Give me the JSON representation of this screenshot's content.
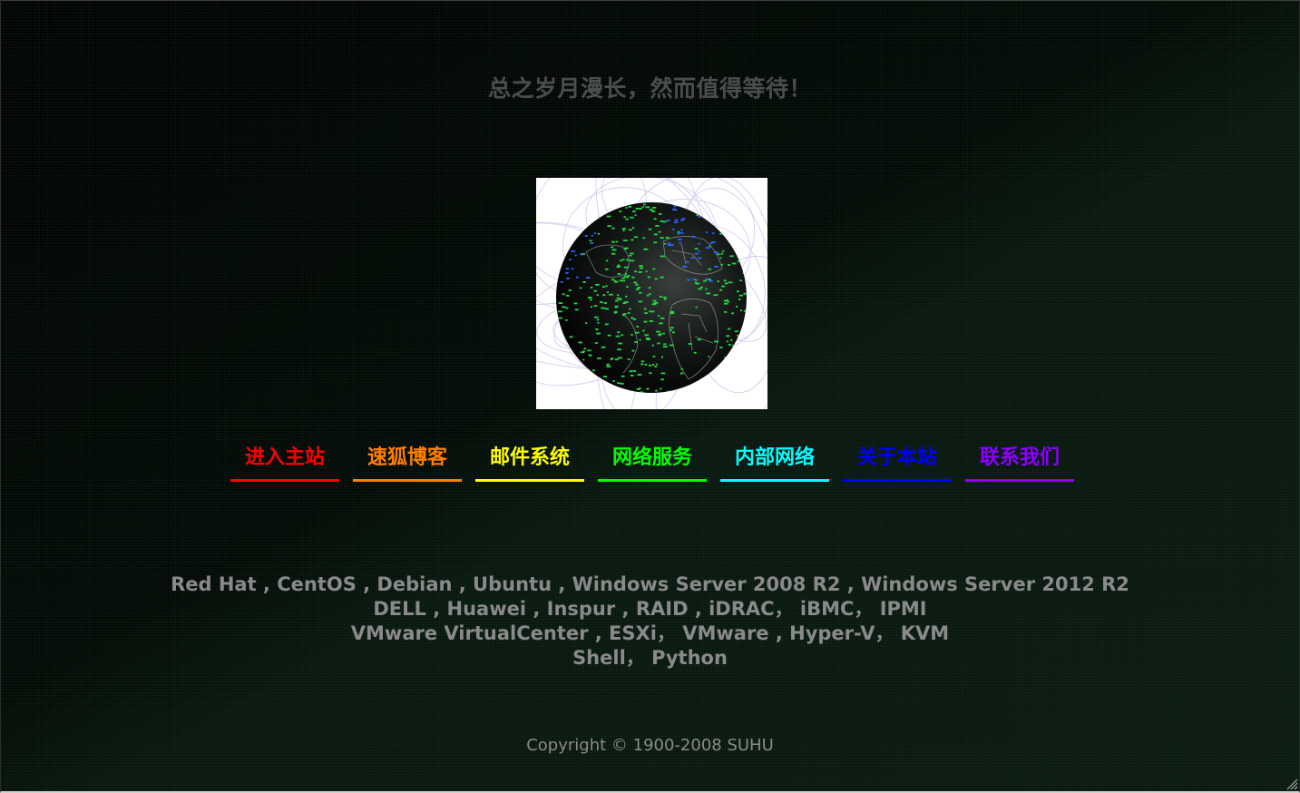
{
  "slogan": "总之岁月漫长，然而值得等待！",
  "globe": {
    "icon": "globe-network-image",
    "background": "#ffffff",
    "ocean": "#101512",
    "node_green": "#22d845",
    "node_blue": "#2a62ff",
    "arc_color": "#b7b3e6"
  },
  "nav": [
    {
      "label": "进入主站",
      "color": "#ff0000"
    },
    {
      "label": "速狐博客",
      "color": "#ff7f00"
    },
    {
      "label": "邮件系统",
      "color": "#ffff00"
    },
    {
      "label": "网络服务",
      "color": "#00ff00"
    },
    {
      "label": "内部网络",
      "color": "#00ffff"
    },
    {
      "label": "关于本站",
      "color": "#0000ff"
    },
    {
      "label": "联系我们",
      "color": "#8b00ff"
    }
  ],
  "tech_lines": [
    "Red Hat , CentOS , Debian , Ubuntu , Windows Server 2008 R2 , Windows Server 2012 R2",
    "DELL , Huawei , Inspur , RAID , iDRAC， iBMC， IPMI",
    "VMware VirtualCenter , ESXi， VMware , Hyper-V， KVM",
    "Shell， Python"
  ],
  "copyright": "Copyright © 1900-2008 SUHU"
}
